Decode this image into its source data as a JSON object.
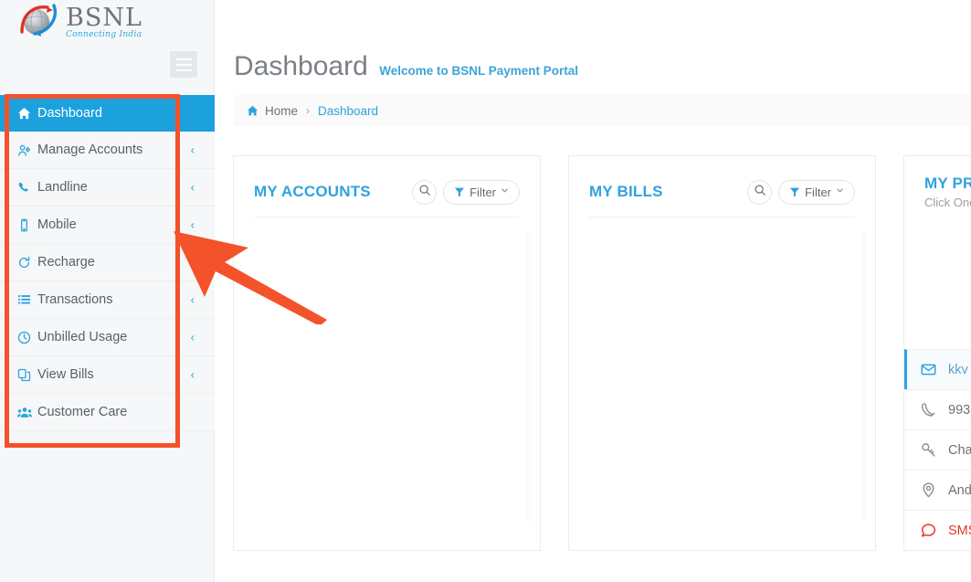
{
  "brand": {
    "name": "BSNL",
    "tagline": "Connecting India",
    "logo_icon": "bsnl-globe-arrow-logo"
  },
  "sidebar": {
    "toggle_icon": "hamburger-icon",
    "items": [
      {
        "label": "Dashboard",
        "icon": "home-icon",
        "active": true,
        "caret": ""
      },
      {
        "label": "Manage Accounts",
        "icon": "users-gear-icon",
        "active": false,
        "caret": "‹"
      },
      {
        "label": "Landline",
        "icon": "phone-icon",
        "active": false,
        "caret": "‹"
      },
      {
        "label": "Mobile",
        "icon": "mobile-icon",
        "active": false,
        "caret": "‹"
      },
      {
        "label": "Recharge",
        "icon": "refresh-icon",
        "active": false,
        "caret": ""
      },
      {
        "label": "Transactions",
        "icon": "list-icon",
        "active": false,
        "caret": "‹"
      },
      {
        "label": "Unbilled Usage",
        "icon": "clock-icon",
        "active": false,
        "caret": "‹"
      },
      {
        "label": "View Bills",
        "icon": "copy-files-icon",
        "active": false,
        "caret": "‹"
      },
      {
        "label": "Customer Care",
        "icon": "people-icon",
        "active": false,
        "caret": ""
      }
    ]
  },
  "header": {
    "title": "Dashboard",
    "subtitle": "Welcome to BSNL Payment Portal"
  },
  "breadcrumb": {
    "home_icon": "home-icon",
    "home": "Home",
    "separator": "›",
    "current": "Dashboard"
  },
  "cards": [
    {
      "title": "MY ACCOUNTS",
      "search_icon": "search-icon",
      "filter_label": "Filter",
      "filter_icon": "funnel-icon",
      "filter_caret_icon": "chevron-down-icon"
    },
    {
      "title": "MY BILLS",
      "search_icon": "search-icon",
      "filter_label": "Filter",
      "filter_icon": "funnel-icon",
      "filter_caret_icon": "chevron-down-icon"
    }
  ],
  "profile_card": {
    "title": "MY PROFILE",
    "subtitle": "Click One",
    "rows": [
      {
        "label": "kkv",
        "icon": "envelope-icon",
        "highlight": true,
        "danger": false
      },
      {
        "label": "993",
        "icon": "phone-handset-icon",
        "highlight": false,
        "danger": false
      },
      {
        "label": "Cha",
        "icon": "key-icon",
        "highlight": false,
        "danger": false
      },
      {
        "label": "And",
        "icon": "location-pin-icon",
        "highlight": false,
        "danger": false
      },
      {
        "label": "SMS",
        "icon": "chat-bubble-icon",
        "highlight": false,
        "danger": true
      }
    ]
  },
  "annotations": {
    "highlight_color": "#f4522a",
    "rectangle_target": "sidebar-menu",
    "arrow_target": "sidebar-menu"
  },
  "colors": {
    "accent_blue": "#2ea3e0",
    "active_blue": "#1ca1dd",
    "annotation_orange": "#f4522a",
    "danger_red": "#e8342a",
    "sidebar_bg": "#f6f7f8"
  }
}
